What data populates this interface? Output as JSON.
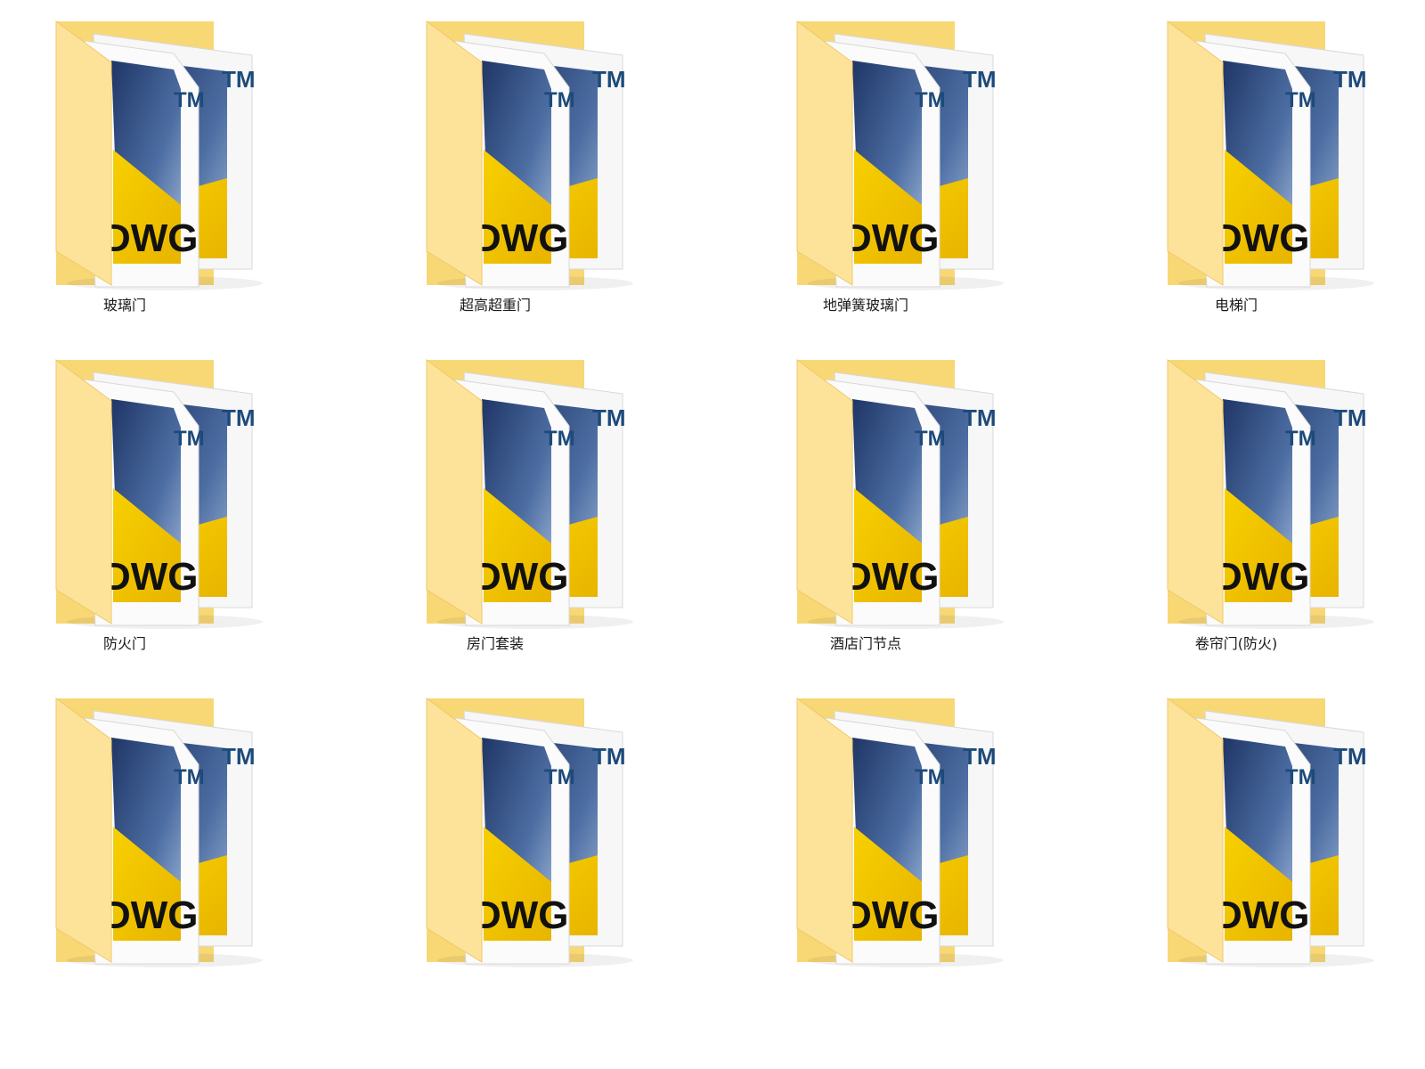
{
  "folders": [
    {
      "name": "玻璃门",
      "icon": "dwg-folder-icon"
    },
    {
      "name": "超高超重门",
      "icon": "dwg-folder-icon"
    },
    {
      "name": "地弹簧玻璃门",
      "icon": "dwg-folder-icon"
    },
    {
      "name": "电梯门",
      "icon": "dwg-folder-icon"
    },
    {
      "name": "防火门",
      "icon": "dwg-folder-icon"
    },
    {
      "name": "房门套装",
      "icon": "dwg-folder-icon"
    },
    {
      "name": "酒店门节点",
      "icon": "dwg-folder-icon"
    },
    {
      "name": "卷帘门(防火)",
      "icon": "dwg-folder-icon"
    },
    {
      "name": "",
      "icon": "dwg-folder-icon"
    },
    {
      "name": "",
      "icon": "dwg-folder-icon"
    },
    {
      "name": "",
      "icon": "dwg-folder-icon"
    },
    {
      "name": "",
      "icon": "dwg-folder-icon"
    }
  ],
  "icon_text": {
    "trademark": "TM",
    "file_type": "DWG"
  },
  "colors": {
    "folder": "#f8d775",
    "folder_light": "#fde9a6",
    "document_blue": "#2e4a7d",
    "dwg_yellow": "#f5c400"
  }
}
